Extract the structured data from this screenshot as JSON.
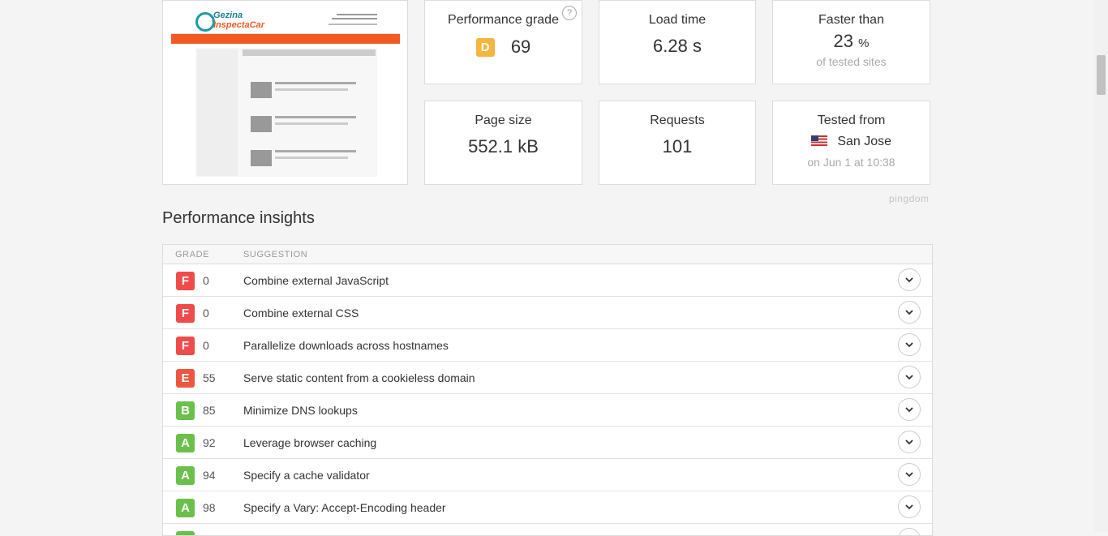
{
  "summary": {
    "grade": {
      "label": "Performance grade",
      "letter": "D",
      "value": "69",
      "help": "?"
    },
    "load_time": {
      "label": "Load time",
      "value": "6.28 s"
    },
    "faster_than": {
      "label": "Faster than",
      "value": "23",
      "unit": "%",
      "sub": "of tested sites"
    },
    "page_size": {
      "label": "Page size",
      "value": "552.1 kB"
    },
    "requests": {
      "label": "Requests",
      "value": "101"
    },
    "tested_from": {
      "label": "Tested from",
      "location": "San Jose",
      "sub": "on Jun 1 at 10:38"
    }
  },
  "thumbnail": {
    "brand_line1": "Gezina",
    "brand_line2": "InspectaCar"
  },
  "brand_mark": "pingdom",
  "insights": {
    "title": "Performance insights",
    "headers": {
      "grade": "GRADE",
      "suggestion": "SUGGESTION"
    },
    "rows": [
      {
        "grade": "F",
        "score": "0",
        "suggestion": "Combine external JavaScript"
      },
      {
        "grade": "F",
        "score": "0",
        "suggestion": "Combine external CSS"
      },
      {
        "grade": "F",
        "score": "0",
        "suggestion": "Parallelize downloads across hostnames"
      },
      {
        "grade": "E",
        "score": "55",
        "suggestion": "Serve static content from a cookieless domain"
      },
      {
        "grade": "B",
        "score": "85",
        "suggestion": "Minimize DNS lookups"
      },
      {
        "grade": "A",
        "score": "92",
        "suggestion": "Leverage browser caching"
      },
      {
        "grade": "A",
        "score": "94",
        "suggestion": "Specify a cache validator"
      },
      {
        "grade": "A",
        "score": "98",
        "suggestion": "Specify a Vary: Accept-Encoding header"
      }
    ]
  },
  "colors": {
    "grade_A": "#6bc04c",
    "grade_B": "#6bc04c",
    "grade_D": "#f5b53e",
    "grade_E": "#ed5742",
    "grade_F": "#ef4b4b",
    "thumbnail_nav": "#f05a23"
  }
}
